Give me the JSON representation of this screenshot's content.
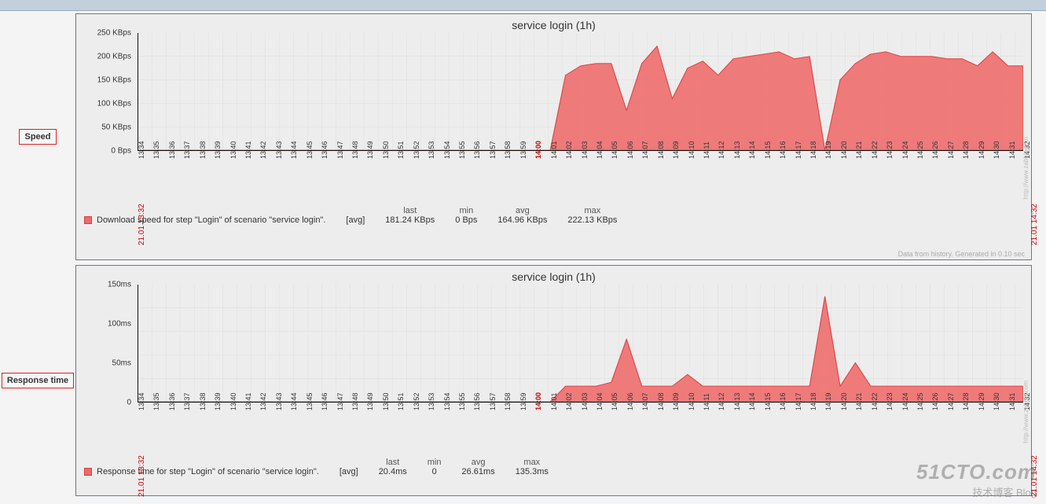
{
  "topbar": {},
  "sidebar": {
    "speed_label": "Speed",
    "response_label": "Response time"
  },
  "charts": {
    "speed": {
      "title": "service login (1h)",
      "ylabels": [
        "0 Bps",
        "50 KBps",
        "100 KBps",
        "150 KBps",
        "200 KBps",
        "250 KBps"
      ],
      "start_label": "21.01 13:32",
      "end_label": "21.01 14:32",
      "legend_text": "Download speed for step \"Login\" of scenario \"service login\".",
      "legend_agg": "[avg]",
      "stats": {
        "last": {
          "h": "last",
          "v": "181.24 KBps"
        },
        "min": {
          "h": "min",
          "v": "0 Bps"
        },
        "avg": {
          "h": "avg",
          "v": "164.96 KBps"
        },
        "max": {
          "h": "max",
          "v": "222.13 KBps"
        }
      },
      "footnote": "Data from history. Generated in 0.10 sec"
    },
    "response": {
      "title": "service login (1h)",
      "ylabels": [
        "0",
        "50ms",
        "100ms",
        "150ms"
      ],
      "start_label": "21.01 13:32",
      "end_label": "21.01 14:32",
      "legend_text": "Response time for step \"Login\" of scenario \"service login\".",
      "legend_agg": "[avg]",
      "stats": {
        "last": {
          "h": "last",
          "v": "20.4ms"
        },
        "min": {
          "h": "min",
          "v": "0"
        },
        "avg": {
          "h": "avg",
          "v": "26.61ms"
        },
        "max": {
          "h": "max",
          "v": "135.3ms"
        }
      }
    }
  },
  "xticks": [
    "13:34",
    "13:35",
    "13:36",
    "13:37",
    "13:38",
    "13:39",
    "13:40",
    "13:41",
    "13:42",
    "13:43",
    "13:44",
    "13:45",
    "13:46",
    "13:47",
    "13:48",
    "13:49",
    "13:50",
    "13:51",
    "13:52",
    "13:53",
    "13:54",
    "13:55",
    "13:56",
    "13:57",
    "13:58",
    "13:59",
    "14:00",
    "14:01",
    "14:02",
    "14:03",
    "14:04",
    "14:05",
    "14:06",
    "14:07",
    "14:08",
    "14:09",
    "14:10",
    "14:11",
    "14:12",
    "14:13",
    "14:14",
    "14:15",
    "14:16",
    "14:17",
    "14:18",
    "14:19",
    "14:20",
    "14:21",
    "14:22",
    "14:23",
    "14:24",
    "14:25",
    "14:26",
    "14:27",
    "14:28",
    "14:29",
    "14:30",
    "14:31",
    "14:32"
  ],
  "xtick_red": "14:00",
  "sidelink": "http://www.zabbix.com",
  "watermark": {
    "big": "51CTO.com",
    "small": "技术博客   Blog"
  },
  "chart_data": [
    {
      "type": "area",
      "title": "service login (1h)",
      "xlabel": "",
      "ylabel": "Download speed",
      "ylim": [
        0,
        250
      ],
      "x": [
        "13:34",
        "13:35",
        "13:36",
        "13:37",
        "13:38",
        "13:39",
        "13:40",
        "13:41",
        "13:42",
        "13:43",
        "13:44",
        "13:45",
        "13:46",
        "13:47",
        "13:48",
        "13:49",
        "13:50",
        "13:51",
        "13:52",
        "13:53",
        "13:54",
        "13:55",
        "13:56",
        "13:57",
        "13:58",
        "13:59",
        "14:00",
        "14:01",
        "14:02",
        "14:03",
        "14:04",
        "14:05",
        "14:06",
        "14:07",
        "14:08",
        "14:09",
        "14:10",
        "14:11",
        "14:12",
        "14:13",
        "14:14",
        "14:15",
        "14:16",
        "14:17",
        "14:18",
        "14:19",
        "14:20",
        "14:21",
        "14:22",
        "14:23",
        "14:24",
        "14:25",
        "14:26",
        "14:27",
        "14:28",
        "14:29",
        "14:30",
        "14:31",
        "14:32"
      ],
      "series": [
        {
          "name": "Download speed for step \"Login\" of scenario \"service login\".",
          "unit": "KBps",
          "values": [
            0,
            0,
            0,
            0,
            0,
            0,
            0,
            0,
            0,
            0,
            0,
            0,
            0,
            0,
            0,
            0,
            0,
            0,
            0,
            0,
            0,
            0,
            0,
            0,
            0,
            0,
            0,
            0,
            160,
            180,
            185,
            185,
            85,
            185,
            222,
            110,
            175,
            190,
            160,
            195,
            200,
            205,
            210,
            195,
            200,
            0,
            150,
            185,
            205,
            210,
            200,
            200,
            200,
            195,
            195,
            180,
            210,
            180,
            180
          ]
        }
      ],
      "stats": {
        "last": "181.24 KBps",
        "min": "0 Bps",
        "avg": "164.96 KBps",
        "max": "222.13 KBps"
      }
    },
    {
      "type": "area",
      "title": "service login (1h)",
      "xlabel": "",
      "ylabel": "Response time",
      "ylim": [
        0,
        150
      ],
      "x": [
        "13:34",
        "13:35",
        "13:36",
        "13:37",
        "13:38",
        "13:39",
        "13:40",
        "13:41",
        "13:42",
        "13:43",
        "13:44",
        "13:45",
        "13:46",
        "13:47",
        "13:48",
        "13:49",
        "13:50",
        "13:51",
        "13:52",
        "13:53",
        "13:54",
        "13:55",
        "13:56",
        "13:57",
        "13:58",
        "13:59",
        "14:00",
        "14:01",
        "14:02",
        "14:03",
        "14:04",
        "14:05",
        "14:06",
        "14:07",
        "14:08",
        "14:09",
        "14:10",
        "14:11",
        "14:12",
        "14:13",
        "14:14",
        "14:15",
        "14:16",
        "14:17",
        "14:18",
        "14:19",
        "14:20",
        "14:21",
        "14:22",
        "14:23",
        "14:24",
        "14:25",
        "14:26",
        "14:27",
        "14:28",
        "14:29",
        "14:30",
        "14:31",
        "14:32"
      ],
      "series": [
        {
          "name": "Response time for step \"Login\" of scenario \"service login\".",
          "unit": "ms",
          "values": [
            0,
            0,
            0,
            0,
            0,
            0,
            0,
            0,
            0,
            0,
            0,
            0,
            0,
            0,
            0,
            0,
            0,
            0,
            0,
            0,
            0,
            0,
            0,
            0,
            0,
            0,
            0,
            0,
            20,
            20,
            20,
            25,
            80,
            20,
            20,
            20,
            35,
            20,
            20,
            20,
            20,
            20,
            20,
            20,
            20,
            135,
            20,
            50,
            20,
            20,
            20,
            20,
            20,
            20,
            20,
            20,
            20,
            20,
            20
          ]
        }
      ],
      "stats": {
        "last": "20.4ms",
        "min": "0",
        "avg": "26.61ms",
        "max": "135.3ms"
      }
    }
  ]
}
